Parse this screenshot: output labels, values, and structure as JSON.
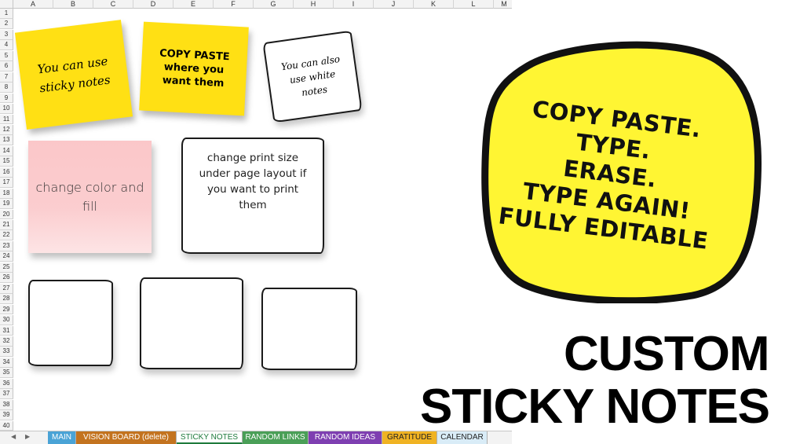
{
  "spreadsheet": {
    "columns": [
      "A",
      "B",
      "C",
      "D",
      "E",
      "F",
      "G",
      "H",
      "I",
      "J",
      "K",
      "L",
      "M"
    ],
    "rows": [
      "1",
      "2",
      "3",
      "4",
      "5",
      "6",
      "7",
      "8",
      "9",
      "10",
      "11",
      "12",
      "13",
      "14",
      "15",
      "16",
      "17",
      "18",
      "19",
      "20",
      "21",
      "22",
      "23",
      "24",
      "25",
      "26",
      "27",
      "28",
      "29",
      "30",
      "31",
      "32",
      "33",
      "34",
      "35",
      "36",
      "37",
      "38",
      "39",
      "40"
    ]
  },
  "notes": {
    "note1": "You can use sticky notes",
    "note2": "COPY PASTE where you want them",
    "note3": "You can also use white notes",
    "note4": "change color and fill",
    "note5": "change print size under page layout if you want to print them"
  },
  "badge": {
    "line1": "COPY PASTE.",
    "line2": "TYPE.",
    "line3": "ERASE.",
    "line4": "TYPE AGAIN!",
    "line5": "FULLY EDITABLE"
  },
  "title": {
    "line1": "CUSTOM",
    "line2": "STICKY NOTES"
  },
  "tabs": [
    {
      "label": "MAIN",
      "color": "#4aa3d6"
    },
    {
      "label": "VISION BOARD (delete)",
      "color": "#c3731f"
    },
    {
      "label": "STICKY NOTES",
      "color": "#ffffff"
    },
    {
      "label": "RANDOM LINKS",
      "color": "#4a9f57"
    },
    {
      "label": "RANDOM IDEAS",
      "color": "#7e3fb1"
    },
    {
      "label": "GRATITUDE",
      "color": "#f0b323"
    },
    {
      "label": "CALENDAR",
      "color": "#d9ecf7"
    }
  ],
  "colors": {
    "yellow": "#ffe014",
    "pink": "#fbc7c9",
    "badge": "#fff533"
  }
}
